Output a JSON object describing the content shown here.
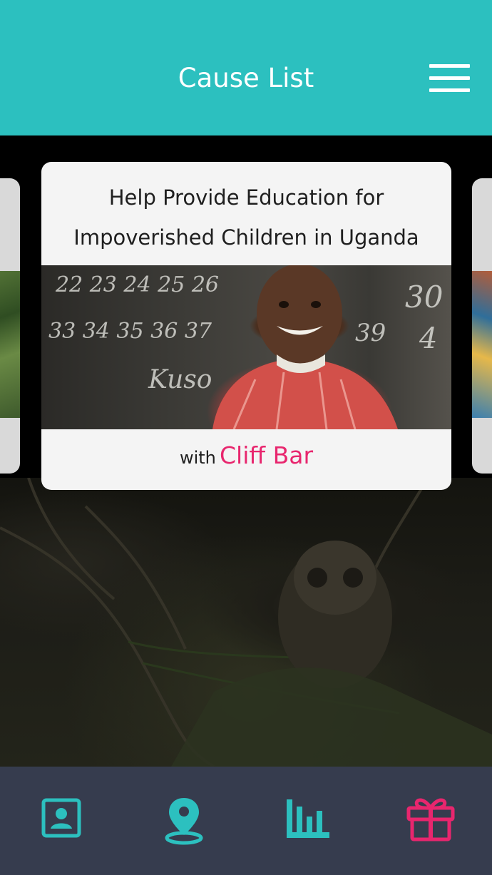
{
  "header": {
    "title": "Cause List",
    "menu_icon": "hamburger-menu-icon"
  },
  "cause_card": {
    "title_line1": "Help Provide Education for",
    "title_line2": "Impoverished Children in Uganda",
    "with_label": "with",
    "sponsor": "Cliff Bar",
    "image_alt": "child-in-front-of-chalkboard-photo",
    "chalkboard_text": [
      "22 23 24 25 26",
      "33 34 35 36 37",
      "Kuso",
      "39",
      "30",
      "4"
    ]
  },
  "tabbar": {
    "tabs": [
      {
        "icon": "profile-icon"
      },
      {
        "icon": "location-pin-icon"
      },
      {
        "icon": "bar-chart-icon"
      },
      {
        "icon": "gift-icon"
      }
    ]
  },
  "colors": {
    "header_bg": "#2cc0bf",
    "accent_pink": "#e8266e",
    "tab_teal": "#2cc0bf",
    "tabbar_bg": "#363c4e"
  }
}
